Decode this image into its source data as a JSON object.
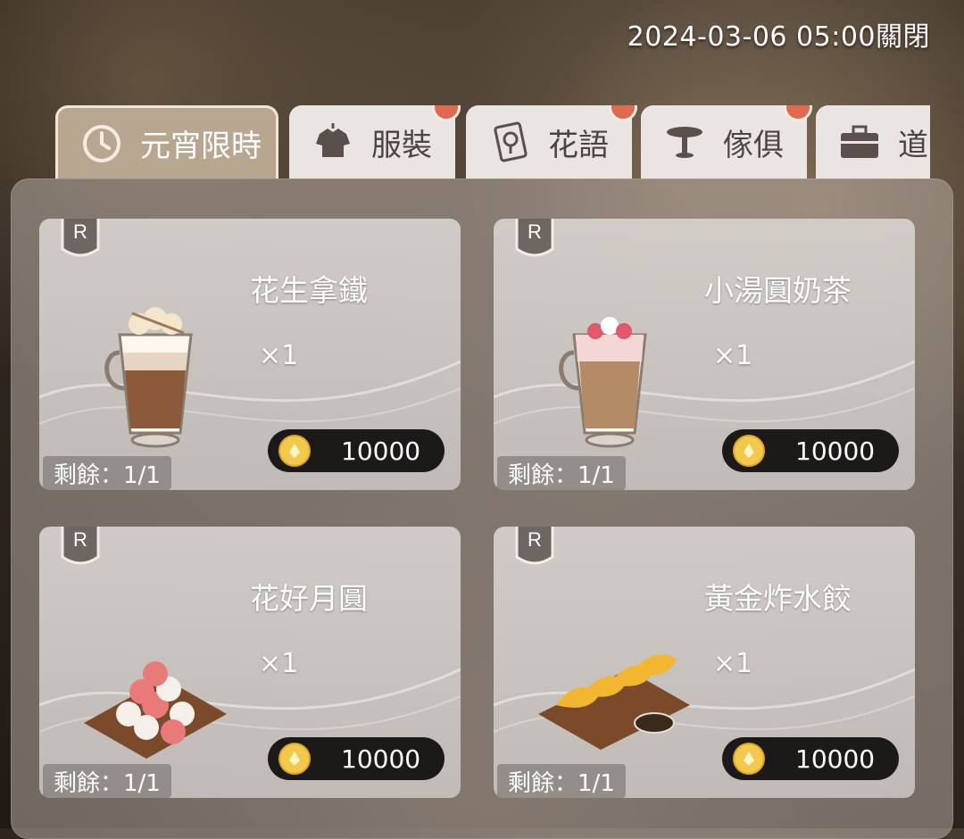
{
  "header": {
    "close_notice": "2024-03-06 05:00關閉"
  },
  "tabs": [
    {
      "label": "元宵限時",
      "icon": "clock-icon",
      "active": true,
      "badge": false
    },
    {
      "label": "服裝",
      "icon": "shirt-icon",
      "active": false,
      "badge": true
    },
    {
      "label": "花語",
      "icon": "rose-card-icon",
      "active": false,
      "badge": true
    },
    {
      "label": "傢俱",
      "icon": "table-icon",
      "active": false,
      "badge": true
    },
    {
      "label": "道",
      "icon": "briefcase-icon",
      "active": false,
      "badge": false
    }
  ],
  "items": [
    {
      "rarity": "R",
      "name": "花生拿鐵",
      "qty": "×1",
      "price": "10000",
      "remaining": "剩餘：1/1",
      "icon": "peanut-latte-icon"
    },
    {
      "rarity": "R",
      "name": "小湯圓奶茶",
      "qty": "×1",
      "price": "10000",
      "remaining": "剩餘：1/1",
      "icon": "tangyuan-milk-tea-icon"
    },
    {
      "rarity": "R",
      "name": "花好月圓",
      "qty": "×1",
      "price": "10000",
      "remaining": "剩餘：1/1",
      "icon": "tangyuan-platter-icon"
    },
    {
      "rarity": "R",
      "name": "黃金炸水餃",
      "qty": "×1",
      "price": "10000",
      "remaining": "剩餘：1/1",
      "icon": "fried-dumplings-icon"
    }
  ],
  "colors": {
    "active_tab": "#b8a690",
    "tab": "#e9e5e2",
    "badge": "#e06a50",
    "price_bg": "#1c1a19",
    "coin": "#f2c94c"
  }
}
